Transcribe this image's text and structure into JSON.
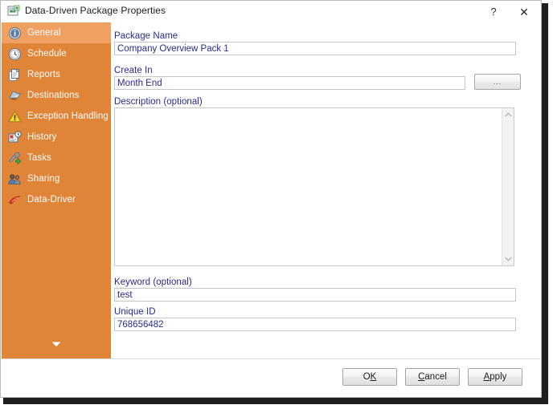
{
  "window": {
    "title": "Data-Driven Package Properties",
    "icon": "package-properties-icon",
    "help_label": "?",
    "close_label": "✕"
  },
  "sidebar": {
    "accent_color": "#e08437",
    "selected_color": "#f0a060",
    "more_icon": "chevron-down-icon",
    "items": [
      {
        "label": "General",
        "icon": "info-icon",
        "selected": true
      },
      {
        "label": "Schedule",
        "icon": "clock-icon",
        "selected": false
      },
      {
        "label": "Reports",
        "icon": "documents-icon",
        "selected": false
      },
      {
        "label": "Destinations",
        "icon": "folder-send-icon",
        "selected": false
      },
      {
        "label": "Exception Handling",
        "icon": "warning-icon",
        "selected": false
      },
      {
        "label": "History",
        "icon": "history-icon",
        "selected": false
      },
      {
        "label": "Tasks",
        "icon": "tools-icon",
        "selected": false
      },
      {
        "label": "Sharing",
        "icon": "people-icon",
        "selected": false
      },
      {
        "label": "Data-Driver",
        "icon": "data-driver-icon",
        "selected": false
      }
    ]
  },
  "general": {
    "package_name": {
      "label": "Package Name",
      "value": "Company Overview Pack 1",
      "placeholder": ""
    },
    "create_in": {
      "label": "Create In",
      "value": "Month End",
      "placeholder": "",
      "browse_label": "..."
    },
    "description": {
      "label": "Description (optional)",
      "value": "",
      "placeholder": ""
    },
    "keyword": {
      "label": "Keyword (optional)",
      "value": "test",
      "placeholder": ""
    },
    "unique_id": {
      "label": "Unique ID",
      "value": "768656482",
      "placeholder": ""
    }
  },
  "footer": {
    "ok": {
      "pre": "O",
      "acc": "K",
      "post": ""
    },
    "cancel": {
      "pre": "",
      "acc": "C",
      "post": "ancel"
    },
    "apply": {
      "pre": "",
      "acc": "A",
      "post": "pply"
    }
  }
}
